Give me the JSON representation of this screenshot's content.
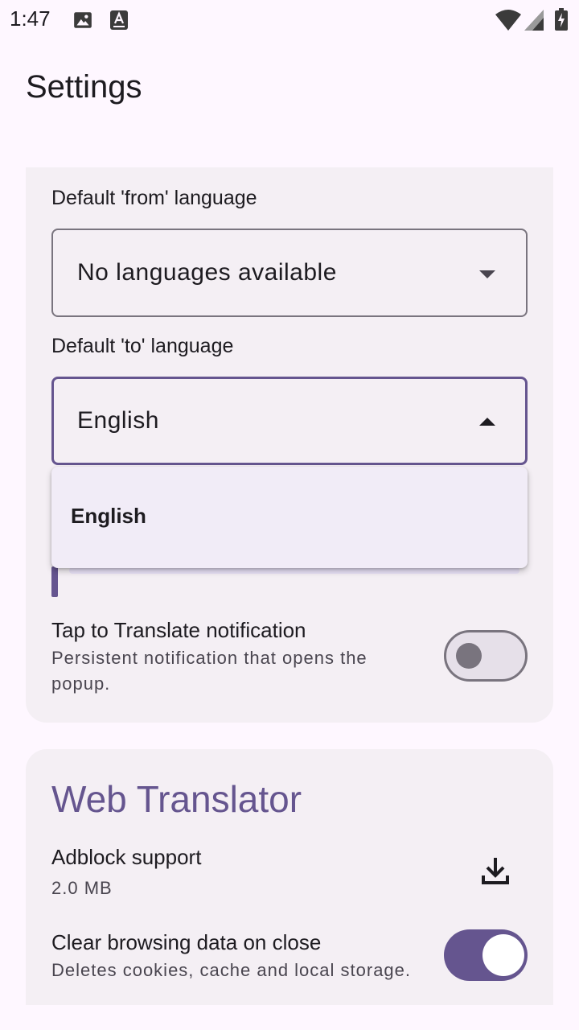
{
  "status_bar": {
    "time": "1:47",
    "icons": [
      "image-icon",
      "text-recognition-icon",
      "wifi-icon",
      "cellular-signal-icon",
      "battery-charging-icon"
    ]
  },
  "app_bar": {
    "title": "Settings"
  },
  "general": {
    "from_label": "Default 'from' language",
    "from_value": "No languages available",
    "to_label": "Default 'to' language",
    "to_value": "English",
    "menu_options": [
      "English"
    ],
    "tap_to_translate": {
      "title": "Tap to Translate notification",
      "subtitle": "Persistent notification that opens the popup.",
      "enabled": false
    }
  },
  "web_translator": {
    "title": "Web Translator",
    "adblock": {
      "title": "Adblock support",
      "size": "2.0 MB"
    },
    "clear_data": {
      "title": "Clear browsing data on close",
      "subtitle": "Deletes cookies, cache and local storage.",
      "enabled": true
    }
  },
  "colors": {
    "accent": "#65558F",
    "background": "#FEF7FF",
    "card": "#F4EFF4",
    "outline": "#79747E"
  }
}
